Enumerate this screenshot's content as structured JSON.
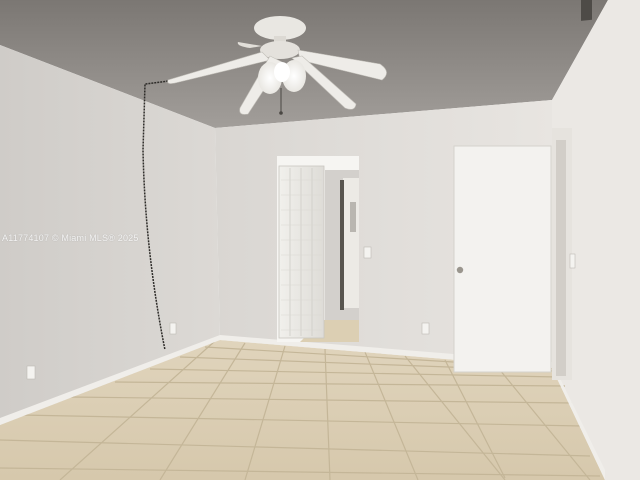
{
  "photo": {
    "subject": "empty-bedroom",
    "watermark": "A11774107 © Miami MLS® 2025"
  },
  "colors": {
    "ceiling": "#8e8a86",
    "left_wall": "#d6d3cf",
    "back_wall": "#e2dfdb",
    "right_wall": "#ebe8e4",
    "floor_tile": "#ddd0b7",
    "grout": "#c9bc9f",
    "door": "#f2f1ee",
    "closet": "#ecebe7"
  }
}
